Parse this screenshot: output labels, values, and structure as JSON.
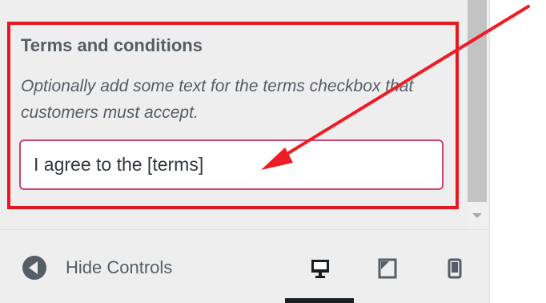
{
  "section": {
    "title": "Terms and conditions",
    "description": "Optionally add some text for the terms checkbox that customers must accept.",
    "input_value": "I agree to the [terms]"
  },
  "footer": {
    "hide_controls_label": "Hide Controls",
    "devices": [
      {
        "name": "desktop",
        "icon": "desktop-icon",
        "active": true
      },
      {
        "name": "tablet",
        "icon": "tablet-icon",
        "active": false
      },
      {
        "name": "mobile",
        "icon": "mobile-icon",
        "active": false
      }
    ]
  },
  "colors": {
    "highlight_border": "#e8161e",
    "annotation_arrow": "#ee1c25",
    "input_focus_border": "#c8466f",
    "panel_background": "#eeeeee",
    "text": "#555d66"
  }
}
